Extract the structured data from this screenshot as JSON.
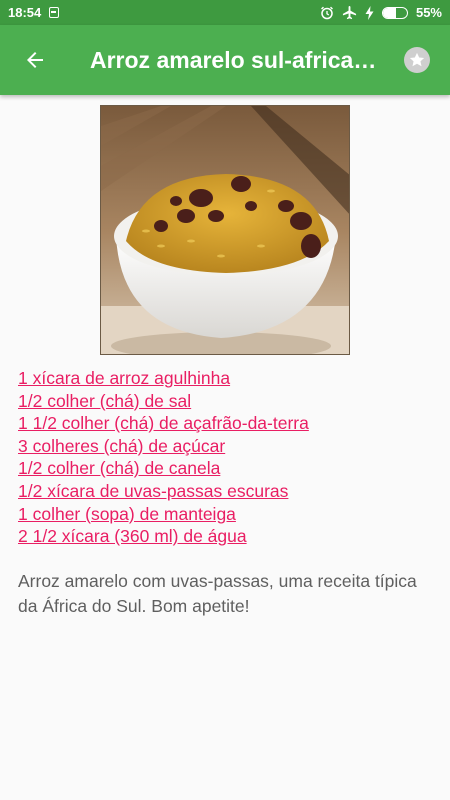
{
  "status_bar": {
    "time": "18:54",
    "battery_percent": "55%",
    "battery_level": 0.55,
    "icons": [
      "notification-icon",
      "alarm-icon",
      "airplane-icon",
      "charging-icon",
      "battery-icon"
    ]
  },
  "app_bar": {
    "title": "Arroz amarelo sul-africano",
    "back_icon": "arrow-left-icon",
    "favorite_icon": "star-icon"
  },
  "recipe": {
    "ingredients": [
      "1 xícara de arroz agulhinha",
      "1/2 colher (chá) de sal",
      "1 1/2 colher (chá) de açafrão-da-terra",
      "3 colheres (chá) de açúcar",
      "1/2 colher (chá) de canela",
      "1/2 xícara de uvas-passas escuras",
      "1 colher (sopa) de manteiga",
      "2 1/2 xícara (360 ml) de água"
    ],
    "description": "Arroz amarelo com uvas-passas, uma receita típica da África do Sul. Bom apetite!"
  },
  "colors": {
    "status_bar": "#3e9a40",
    "app_bar": "#4caf50",
    "ingredient_link": "#e91e63",
    "description_text": "#5f5f5f"
  }
}
